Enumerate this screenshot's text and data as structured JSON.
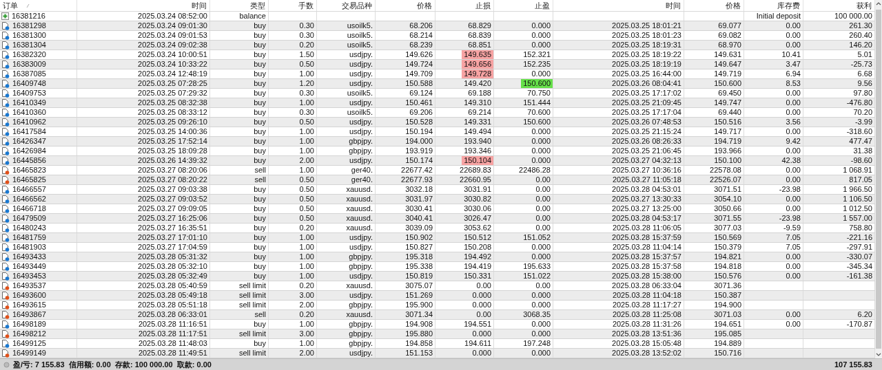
{
  "columns": [
    "订单",
    "时间",
    "类型",
    "手数",
    "交易品种",
    "价格",
    "止损",
    "止盈",
    "时间",
    "价格",
    "库存费",
    "获利"
  ],
  "rows": [
    {
      "kind": "balance",
      "order": "16381216",
      "open_time": "2025.03.24 08:52:00",
      "type": "balance",
      "comment": "Initial deposit",
      "profit": "100 000.00",
      "sl_hit": false,
      "tp_hit": false
    },
    {
      "kind": "buy",
      "order": "16381298",
      "open_time": "2025.03.24 09:01:30",
      "type": "buy",
      "lots": "0.30",
      "symbol": "usoilk5.",
      "open_price": "68.206",
      "sl": "68.829",
      "tp": "0.000",
      "close_time": "2025.03.25 18:01:21",
      "close_price": "69.077",
      "swap": "0.00",
      "profit": "261.30",
      "sl_hit": false,
      "tp_hit": false
    },
    {
      "kind": "buy",
      "order": "16381300",
      "open_time": "2025.03.24 09:01:53",
      "type": "buy",
      "lots": "0.30",
      "symbol": "usoilk5.",
      "open_price": "68.214",
      "sl": "68.839",
      "tp": "0.000",
      "close_time": "2025.03.25 18:01:23",
      "close_price": "69.082",
      "swap": "0.00",
      "profit": "260.40",
      "sl_hit": false,
      "tp_hit": false
    },
    {
      "kind": "buy",
      "order": "16381304",
      "open_time": "2025.03.24 09:02:38",
      "type": "buy",
      "lots": "0.20",
      "symbol": "usoilk5.",
      "open_price": "68.239",
      "sl": "68.851",
      "tp": "0.000",
      "close_time": "2025.03.25 18:19:31",
      "close_price": "68.970",
      "swap": "0.00",
      "profit": "146.20",
      "sl_hit": false,
      "tp_hit": false
    },
    {
      "kind": "buy",
      "order": "16382320",
      "open_time": "2025.03.24 10:00:51",
      "type": "buy",
      "lots": "1.50",
      "symbol": "usdjpy.",
      "open_price": "149.626",
      "sl": "149.635",
      "tp": "152.321",
      "close_time": "2025.03.25 18:19:22",
      "close_price": "149.631",
      "swap": "10.41",
      "profit": "5.01",
      "sl_hit": true,
      "tp_hit": false
    },
    {
      "kind": "buy",
      "order": "16383009",
      "open_time": "2025.03.24 10:33:22",
      "type": "buy",
      "lots": "0.50",
      "symbol": "usdjpy.",
      "open_price": "149.724",
      "sl": "149.656",
      "tp": "152.235",
      "close_time": "2025.03.25 18:19:19",
      "close_price": "149.647",
      "swap": "3.47",
      "profit": "-25.73",
      "sl_hit": true,
      "tp_hit": false
    },
    {
      "kind": "buy",
      "order": "16387085",
      "open_time": "2025.03.24 12:48:19",
      "type": "buy",
      "lots": "1.00",
      "symbol": "usdjpy.",
      "open_price": "149.709",
      "sl": "149.728",
      "tp": "0.000",
      "close_time": "2025.03.25 16:44:00",
      "close_price": "149.719",
      "swap": "6.94",
      "profit": "6.68",
      "sl_hit": true,
      "tp_hit": false
    },
    {
      "kind": "buy",
      "order": "16409748",
      "open_time": "2025.03.25 07:28:25",
      "type": "buy",
      "lots": "1.20",
      "symbol": "usdjpy.",
      "open_price": "150.588",
      "sl": "149.420",
      "tp": "150.600",
      "close_time": "2025.03.26 08:04:41",
      "close_price": "150.600",
      "swap": "8.53",
      "profit": "9.56",
      "sl_hit": false,
      "tp_hit": true
    },
    {
      "kind": "buy",
      "order": "16409753",
      "open_time": "2025.03.25 07:29:32",
      "type": "buy",
      "lots": "0.30",
      "symbol": "usoilk5.",
      "open_price": "69.124",
      "sl": "69.188",
      "tp": "70.750",
      "close_time": "2025.03.25 17:17:02",
      "close_price": "69.450",
      "swap": "0.00",
      "profit": "97.80",
      "sl_hit": false,
      "tp_hit": false
    },
    {
      "kind": "buy",
      "order": "16410349",
      "open_time": "2025.03.25 08:32:38",
      "type": "buy",
      "lots": "1.00",
      "symbol": "usdjpy.",
      "open_price": "150.461",
      "sl": "149.310",
      "tp": "151.444",
      "close_time": "2025.03.25 21:09:45",
      "close_price": "149.747",
      "swap": "0.00",
      "profit": "-476.80",
      "sl_hit": false,
      "tp_hit": false
    },
    {
      "kind": "buy",
      "order": "16410360",
      "open_time": "2025.03.25 08:33:12",
      "type": "buy",
      "lots": "0.30",
      "symbol": "usoilk5.",
      "open_price": "69.206",
      "sl": "69.214",
      "tp": "70.600",
      "close_time": "2025.03.25 17:17:04",
      "close_price": "69.440",
      "swap": "0.00",
      "profit": "70.20",
      "sl_hit": false,
      "tp_hit": false
    },
    {
      "kind": "buy",
      "order": "16410962",
      "open_time": "2025.03.25 09:26:10",
      "type": "buy",
      "lots": "0.50",
      "symbol": "usdjpy.",
      "open_price": "150.528",
      "sl": "149.331",
      "tp": "150.600",
      "close_time": "2025.03.26 07:48:53",
      "close_price": "150.516",
      "swap": "3.56",
      "profit": "-3.99",
      "sl_hit": false,
      "tp_hit": false
    },
    {
      "kind": "buy",
      "order": "16417584",
      "open_time": "2025.03.25 14:00:36",
      "type": "buy",
      "lots": "1.00",
      "symbol": "usdjpy.",
      "open_price": "150.194",
      "sl": "149.494",
      "tp": "0.000",
      "close_time": "2025.03.25 21:15:24",
      "close_price": "149.717",
      "swap": "0.00",
      "profit": "-318.60",
      "sl_hit": false,
      "tp_hit": false
    },
    {
      "kind": "buy",
      "order": "16426347",
      "open_time": "2025.03.25 17:52:14",
      "type": "buy",
      "lots": "1.00",
      "symbol": "gbpjpy.",
      "open_price": "194.000",
      "sl": "193.940",
      "tp": "0.000",
      "close_time": "2025.03.26 08:26:33",
      "close_price": "194.719",
      "swap": "9.42",
      "profit": "477.47",
      "sl_hit": false,
      "tp_hit": false
    },
    {
      "kind": "buy",
      "order": "16426984",
      "open_time": "2025.03.25 18:09:28",
      "type": "buy",
      "lots": "1.00",
      "symbol": "gbpjpy.",
      "open_price": "193.919",
      "sl": "193.346",
      "tp": "0.000",
      "close_time": "2025.03.25 21:06:45",
      "close_price": "193.966",
      "swap": "0.00",
      "profit": "31.38",
      "sl_hit": false,
      "tp_hit": false
    },
    {
      "kind": "buy",
      "order": "16445856",
      "open_time": "2025.03.26 14:39:32",
      "type": "buy",
      "lots": "2.00",
      "symbol": "usdjpy.",
      "open_price": "150.174",
      "sl": "150.104",
      "tp": "0.000",
      "close_time": "2025.03.27 04:32:13",
      "close_price": "150.100",
      "swap": "42.38",
      "profit": "-98.60",
      "sl_hit": true,
      "tp_hit": false
    },
    {
      "kind": "sell",
      "order": "16465823",
      "open_time": "2025.03.27 08:20:06",
      "type": "sell",
      "lots": "1.00",
      "symbol": "ger40.",
      "open_price": "22677.42",
      "sl": "22689.83",
      "tp": "22486.28",
      "close_time": "2025.03.27 10:36:16",
      "close_price": "22578.08",
      "swap": "0.00",
      "profit": "1 068.91",
      "sl_hit": false,
      "tp_hit": false
    },
    {
      "kind": "sell",
      "order": "16465825",
      "open_time": "2025.03.27 08:20:22",
      "type": "sell",
      "lots": "0.50",
      "symbol": "ger40.",
      "open_price": "22677.93",
      "sl": "22660.95",
      "tp": "0.00",
      "close_time": "2025.03.27 11:05:18",
      "close_price": "22526.07",
      "swap": "0.00",
      "profit": "817.05",
      "sl_hit": false,
      "tp_hit": false
    },
    {
      "kind": "buy",
      "order": "16466557",
      "open_time": "2025.03.27 09:03:38",
      "type": "buy",
      "lots": "0.50",
      "symbol": "xauusd.",
      "open_price": "3032.18",
      "sl": "3031.91",
      "tp": "0.00",
      "close_time": "2025.03.28 04:53:01",
      "close_price": "3071.51",
      "swap": "-23.98",
      "profit": "1 966.50",
      "sl_hit": false,
      "tp_hit": false
    },
    {
      "kind": "buy",
      "order": "16466562",
      "open_time": "2025.03.27 09:03:52",
      "type": "buy",
      "lots": "0.50",
      "symbol": "xauusd.",
      "open_price": "3031.97",
      "sl": "3030.82",
      "tp": "0.00",
      "close_time": "2025.03.27 13:30:33",
      "close_price": "3054.10",
      "swap": "0.00",
      "profit": "1 106.50",
      "sl_hit": false,
      "tp_hit": false
    },
    {
      "kind": "buy",
      "order": "16466718",
      "open_time": "2025.03.27 09:09:05",
      "type": "buy",
      "lots": "0.50",
      "symbol": "xauusd.",
      "open_price": "3030.41",
      "sl": "3030.06",
      "tp": "0.00",
      "close_time": "2025.03.27 13:25:00",
      "close_price": "3050.66",
      "swap": "0.00",
      "profit": "1 012.50",
      "sl_hit": false,
      "tp_hit": false
    },
    {
      "kind": "buy",
      "order": "16479509",
      "open_time": "2025.03.27 16:25:06",
      "type": "buy",
      "lots": "0.50",
      "symbol": "xauusd.",
      "open_price": "3040.41",
      "sl": "3026.47",
      "tp": "0.00",
      "close_time": "2025.03.28 04:53:17",
      "close_price": "3071.55",
      "swap": "-23.98",
      "profit": "1 557.00",
      "sl_hit": false,
      "tp_hit": false
    },
    {
      "kind": "buy",
      "order": "16480243",
      "open_time": "2025.03.27 16:35:51",
      "type": "buy",
      "lots": "0.20",
      "symbol": "xauusd.",
      "open_price": "3039.09",
      "sl": "3053.62",
      "tp": "0.00",
      "close_time": "2025.03.28 11:06:05",
      "close_price": "3077.03",
      "swap": "-9.59",
      "profit": "758.80",
      "sl_hit": false,
      "tp_hit": false
    },
    {
      "kind": "buy",
      "order": "16481759",
      "open_time": "2025.03.27 17:01:10",
      "type": "buy",
      "lots": "1.00",
      "symbol": "usdjpy.",
      "open_price": "150.902",
      "sl": "150.512",
      "tp": "151.052",
      "close_time": "2025.03.28 15:37:59",
      "close_price": "150.569",
      "swap": "7.05",
      "profit": "-221.16",
      "sl_hit": false,
      "tp_hit": false
    },
    {
      "kind": "buy",
      "order": "16481903",
      "open_time": "2025.03.27 17:04:59",
      "type": "buy",
      "lots": "1.00",
      "symbol": "usdjpy.",
      "open_price": "150.827",
      "sl": "150.208",
      "tp": "0.000",
      "close_time": "2025.03.28 11:04:14",
      "close_price": "150.379",
      "swap": "7.05",
      "profit": "-297.91",
      "sl_hit": false,
      "tp_hit": false
    },
    {
      "kind": "buy",
      "order": "16493433",
      "open_time": "2025.03.28 05:31:32",
      "type": "buy",
      "lots": "1.00",
      "symbol": "gbpjpy.",
      "open_price": "195.318",
      "sl": "194.492",
      "tp": "0.000",
      "close_time": "2025.03.28 15:37:57",
      "close_price": "194.821",
      "swap": "0.00",
      "profit": "-330.07",
      "sl_hit": false,
      "tp_hit": false
    },
    {
      "kind": "buy",
      "order": "16493449",
      "open_time": "2025.03.28 05:32:10",
      "type": "buy",
      "lots": "1.00",
      "symbol": "gbpjpy.",
      "open_price": "195.338",
      "sl": "194.419",
      "tp": "195.633",
      "close_time": "2025.03.28 15:37:58",
      "close_price": "194.818",
      "swap": "0.00",
      "profit": "-345.34",
      "sl_hit": false,
      "tp_hit": false
    },
    {
      "kind": "buy",
      "order": "16493453",
      "open_time": "2025.03.28 05:32:49",
      "type": "buy",
      "lots": "1.00",
      "symbol": "usdjpy.",
      "open_price": "150.819",
      "sl": "150.331",
      "tp": "151.022",
      "close_time": "2025.03.28 15:38:00",
      "close_price": "150.576",
      "swap": "0.00",
      "profit": "-161.38",
      "sl_hit": false,
      "tp_hit": false
    },
    {
      "kind": "sell",
      "order": "16493537",
      "open_time": "2025.03.28 05:40:59",
      "type": "sell limit",
      "lots": "0.20",
      "symbol": "xauusd.",
      "open_price": "3075.07",
      "sl": "0.00",
      "tp": "0.00",
      "close_time": "2025.03.28 06:33:04",
      "close_price": "3071.36",
      "sl_hit": false,
      "tp_hit": false
    },
    {
      "kind": "sell",
      "order": "16493600",
      "open_time": "2025.03.28 05:49:18",
      "type": "sell limit",
      "lots": "3.00",
      "symbol": "usdjpy.",
      "open_price": "151.269",
      "sl": "0.000",
      "tp": "0.000",
      "close_time": "2025.03.28 11:04:18",
      "close_price": "150.387",
      "sl_hit": false,
      "tp_hit": false
    },
    {
      "kind": "sell",
      "order": "16493615",
      "open_time": "2025.03.28 05:51:18",
      "type": "sell limit",
      "lots": "2.00",
      "symbol": "gbpjpy.",
      "open_price": "195.900",
      "sl": "0.000",
      "tp": "0.000",
      "close_time": "2025.03.28 11:17:27",
      "close_price": "194.900",
      "sl_hit": false,
      "tp_hit": false
    },
    {
      "kind": "sell",
      "order": "16493867",
      "open_time": "2025.03.28 06:33:01",
      "type": "sell",
      "lots": "0.20",
      "symbol": "xauusd.",
      "open_price": "3071.34",
      "sl": "0.00",
      "tp": "3068.35",
      "close_time": "2025.03.28 11:25:08",
      "close_price": "3071.03",
      "swap": "0.00",
      "profit": "6.20",
      "sl_hit": false,
      "tp_hit": false
    },
    {
      "kind": "buy",
      "order": "16498189",
      "open_time": "2025.03.28 11:16:51",
      "type": "buy",
      "lots": "1.00",
      "symbol": "gbpjpy.",
      "open_price": "194.908",
      "sl": "194.551",
      "tp": "0.000",
      "close_time": "2025.03.28 11:31:26",
      "close_price": "194.651",
      "swap": "0.00",
      "profit": "-170.87",
      "sl_hit": false,
      "tp_hit": false
    },
    {
      "kind": "sell",
      "order": "16498212",
      "open_time": "2025.03.28 11:17:51",
      "type": "sell limit",
      "lots": "3.00",
      "symbol": "gbpjpy.",
      "open_price": "195.880",
      "sl": "0.000",
      "tp": "0.000",
      "close_time": "2025.03.28 13:51:36",
      "close_price": "195.085",
      "sl_hit": false,
      "tp_hit": false
    },
    {
      "kind": "buy",
      "order": "16499125",
      "open_time": "2025.03.28 11:48:03",
      "type": "buy",
      "lots": "1.00",
      "symbol": "gbpjpy.",
      "open_price": "194.858",
      "sl": "194.611",
      "tp": "197.248",
      "close_time": "2025.03.28 15:05:48",
      "close_price": "194.889",
      "sl_hit": false,
      "tp_hit": false
    },
    {
      "kind": "sell",
      "order": "16499149",
      "open_time": "2025.03.28 11:49:51",
      "type": "sell limit",
      "lots": "2.00",
      "symbol": "usdjpy.",
      "open_price": "151.153",
      "sl": "0.000",
      "tp": "0.000",
      "close_time": "2025.03.28 13:52:02",
      "close_price": "150.716",
      "sl_hit": false,
      "tp_hit": false
    }
  ],
  "status_bar": {
    "summary": "盈/亏: 7 155.83  信用额: 0.00  存款: 100 000.00  取款: 0.00",
    "total": "107 155.83"
  }
}
